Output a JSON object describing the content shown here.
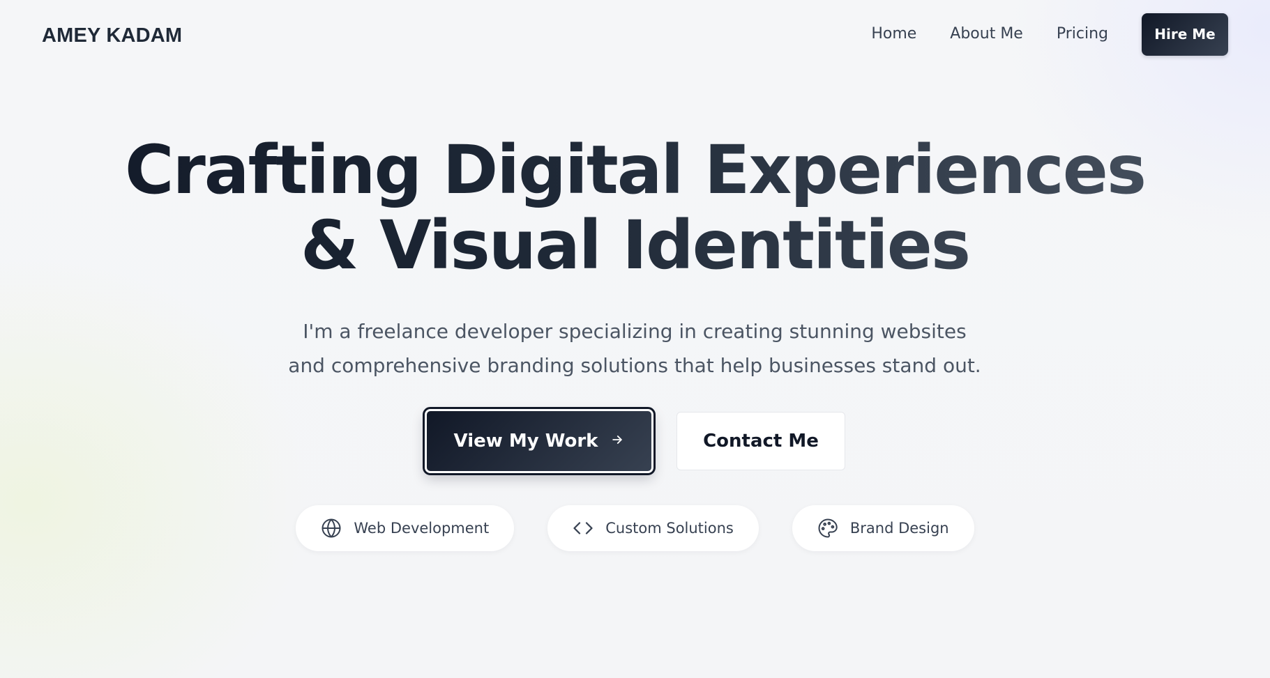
{
  "brand": {
    "name": "AMEY KADAM"
  },
  "nav": {
    "links": [
      {
        "label": "Home"
      },
      {
        "label": "About Me"
      },
      {
        "label": "Pricing"
      }
    ],
    "cta_label": "Hire Me"
  },
  "hero": {
    "title_line_1": "Crafting Digital Experiences",
    "title_line_2": "& Visual Identities",
    "subtitle": "I'm a freelance developer specializing in creating stunning websites and comprehensive branding solutions that help businesses stand out.",
    "primary_cta": {
      "label": "View My Work",
      "icon": "arrow-right-icon"
    },
    "secondary_cta": {
      "label": "Contact Me"
    }
  },
  "services": [
    {
      "label": "Web Development",
      "icon": "globe-icon"
    },
    {
      "label": "Custom Solutions",
      "icon": "code-icon"
    },
    {
      "label": "Brand Design",
      "icon": "palette-icon"
    }
  ],
  "colors": {
    "primary_dark": "#111827",
    "primary_mid": "#374151",
    "text_muted": "#4b5563",
    "background": "#f4f5f7"
  }
}
